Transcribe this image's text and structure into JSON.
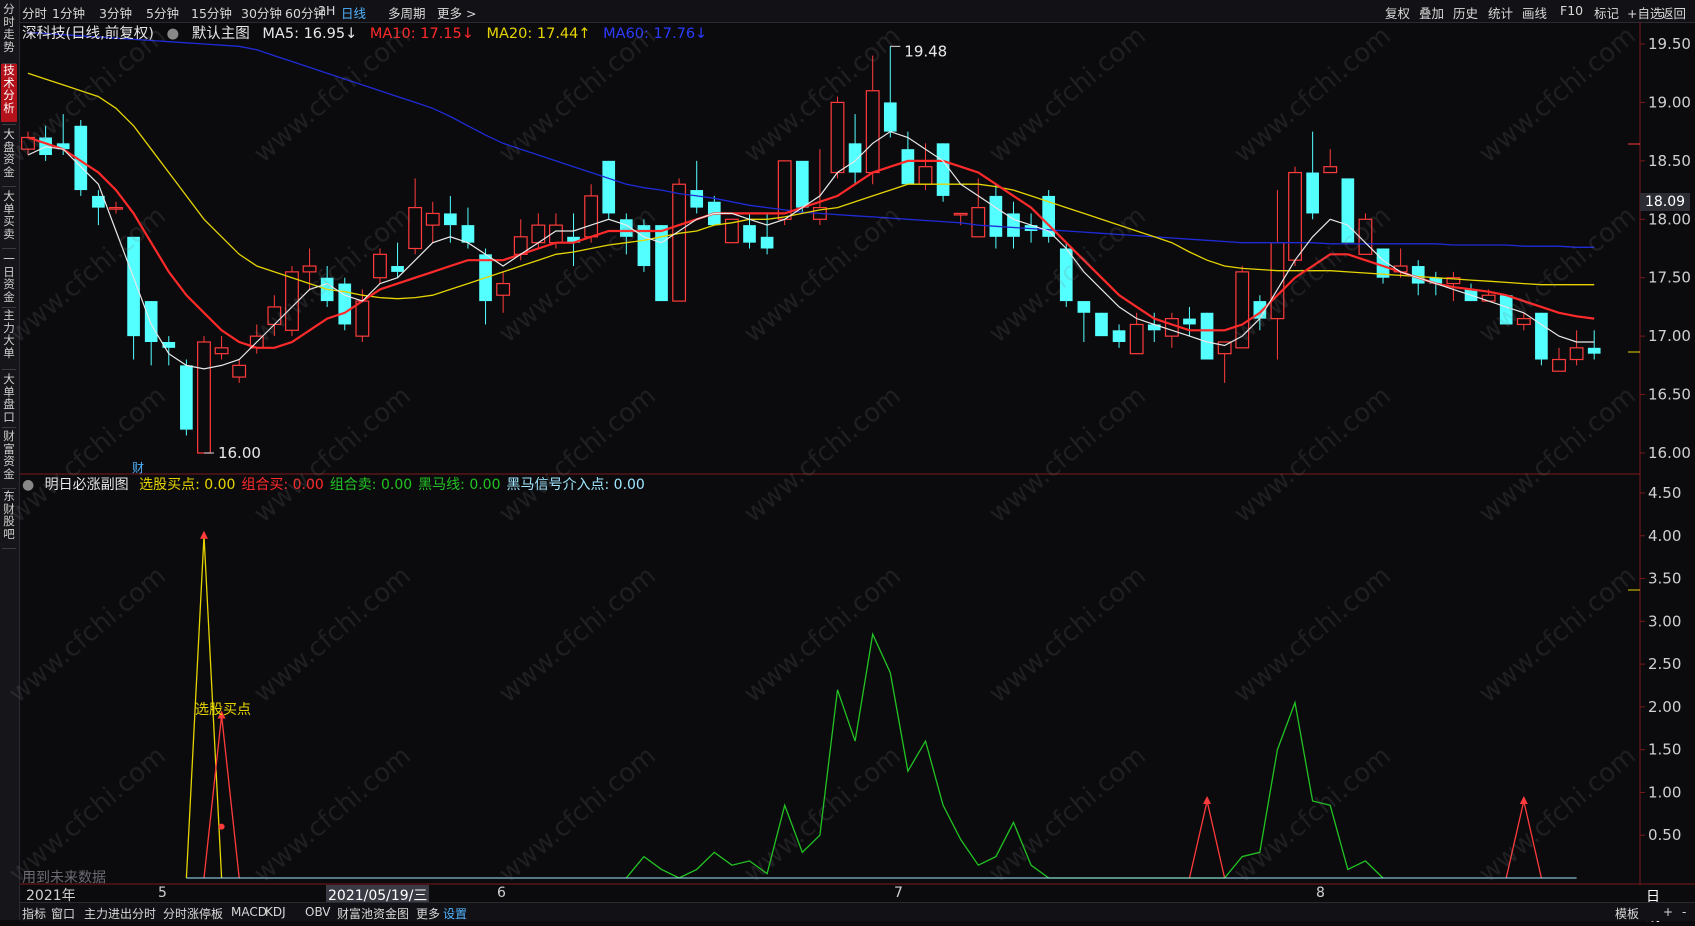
{
  "toolbar": {
    "left_items": [
      "分时",
      "1分钟",
      "3分钟",
      "5分钟",
      "15分钟",
      "30分钟",
      "60分钟",
      "2H",
      "日线",
      "多周期",
      "更多 >"
    ],
    "active": "日线",
    "right_items": [
      "复权",
      "叠加",
      "历史",
      "统计",
      "画线",
      "F10",
      "标记",
      "+自选",
      "返回"
    ]
  },
  "sidebar": {
    "items": [
      "分时走势",
      "技术分析",
      "大盘资金",
      "大单买卖",
      "一日资金",
      "主力大单",
      "大单盘口",
      "财富资金",
      "东财股吧"
    ],
    "active": "技术分析"
  },
  "main_info": {
    "stock": "深科技(日线,前复权)",
    "template": "默认主图",
    "ma5": "MA5: 16.95↓",
    "ma10": "MA10: 17.15↓",
    "ma20": "MA20: 17.44↑",
    "ma60": "MA60: 17.76↓"
  },
  "colors": {
    "up": "#ff3b3b",
    "down": "#54ffff",
    "ma5": "#e8e8e8",
    "ma10": "#ff2a2a",
    "ma20": "#e6d400",
    "ma60": "#1e2bd6"
  },
  "price_axis": {
    "labels": [
      "19.50",
      "19.00",
      "18.50",
      "18.00",
      "17.50",
      "17.00",
      "16.50",
      "16.00"
    ],
    "current": "18.09",
    "high_marker": "19.48",
    "low_marker": "16.00",
    "cai_marker": "财"
  },
  "indicator": {
    "title": "明日必涨副图",
    "items": [
      {
        "text": "选股买点: 0.00",
        "color": "#e6d400"
      },
      {
        "text": "组合买: 0.00",
        "color": "#ff2a2a"
      },
      {
        "text": "组合卖: 0.00",
        "color": "#22c322"
      },
      {
        "text": "黑马线: 0.00",
        "color": "#22c322"
      },
      {
        "text": "黑马信号介入点: 0.00",
        "color": "#9fe8ff"
      }
    ],
    "axis_labels": [
      "4.50",
      "4.00",
      "3.50",
      "3.00",
      "2.50",
      "2.00",
      "1.50",
      "1.00",
      "0.50"
    ],
    "buy_point_label": "选股买点",
    "future_data_label": "用到未来数据"
  },
  "x_axis": {
    "labels": [
      "2021年",
      "5",
      "2021/05/19/三",
      "6",
      "7",
      "8"
    ],
    "period_label": "日线"
  },
  "bottom_tabs": {
    "items": [
      "指标",
      "窗口",
      "主力进出分时",
      "分时涨停板",
      "MACD",
      "KDJ",
      "OBV",
      "财富池资金图",
      "更多",
      "设置"
    ],
    "active": "设置",
    "right": [
      "模板",
      "+",
      "-"
    ]
  },
  "watermark": "www.cfchi.com",
  "chart_data": [
    {
      "type": "candlestick",
      "title": "深科技(日线,前复权)",
      "ylim": [
        15.9,
        19.7
      ],
      "candles": [
        [
          18.6,
          18.7,
          18.55,
          18.75
        ],
        [
          18.7,
          18.55,
          18.5,
          18.8
        ],
        [
          18.65,
          18.6,
          18.55,
          18.9
        ],
        [
          18.8,
          18.25,
          18.2,
          18.85
        ],
        [
          18.2,
          18.1,
          17.95,
          18.25
        ],
        [
          18.1,
          18.1,
          18.05,
          18.15
        ],
        [
          17.85,
          17.0,
          16.8,
          17.85
        ],
        [
          17.3,
          16.95,
          16.75,
          17.3
        ],
        [
          16.95,
          16.9,
          16.75,
          17.0
        ],
        [
          16.75,
          16.2,
          16.15,
          16.8
        ],
        [
          16.0,
          16.95,
          16.0,
          17.0
        ],
        [
          16.85,
          16.9,
          16.8,
          17.0
        ],
        [
          16.65,
          16.75,
          16.6,
          16.8
        ],
        [
          16.9,
          17.0,
          16.85,
          17.1
        ],
        [
          17.1,
          17.25,
          17.0,
          17.35
        ],
        [
          17.05,
          17.55,
          17.0,
          17.6
        ],
        [
          17.55,
          17.6,
          17.4,
          17.75
        ],
        [
          17.5,
          17.3,
          17.25,
          17.6
        ],
        [
          17.45,
          17.1,
          17.05,
          17.5
        ],
        [
          17.0,
          17.3,
          16.95,
          17.4
        ],
        [
          17.5,
          17.7,
          17.45,
          17.75
        ],
        [
          17.6,
          17.55,
          17.5,
          17.8
        ],
        [
          17.75,
          18.1,
          17.7,
          18.35
        ],
        [
          17.95,
          18.05,
          17.8,
          18.15
        ],
        [
          18.05,
          17.95,
          17.8,
          18.2
        ],
        [
          17.95,
          17.8,
          17.75,
          18.1
        ],
        [
          17.7,
          17.3,
          17.1,
          17.75
        ],
        [
          17.35,
          17.45,
          17.2,
          17.55
        ],
        [
          17.7,
          17.85,
          17.65,
          18.0
        ],
        [
          17.8,
          17.95,
          17.75,
          18.05
        ],
        [
          17.8,
          17.95,
          17.75,
          18.05
        ],
        [
          17.85,
          17.8,
          17.6,
          18.05
        ],
        [
          17.85,
          18.2,
          17.8,
          18.3
        ],
        [
          18.5,
          18.05,
          18.0,
          18.5
        ],
        [
          18.0,
          17.85,
          17.7,
          18.05
        ],
        [
          17.95,
          17.6,
          17.55,
          18.0
        ],
        [
          17.95,
          17.3,
          17.3,
          17.95
        ],
        [
          17.3,
          18.3,
          17.3,
          18.35
        ],
        [
          18.25,
          18.1,
          18.05,
          18.5
        ],
        [
          18.15,
          17.95,
          17.95,
          18.2
        ],
        [
          17.8,
          18.0,
          17.85,
          18.0
        ],
        [
          17.95,
          17.8,
          17.75,
          18.05
        ],
        [
          17.85,
          17.75,
          17.7,
          18.05
        ],
        [
          18.0,
          18.5,
          17.95,
          18.5
        ],
        [
          18.5,
          18.1,
          18.05,
          18.5
        ],
        [
          18.0,
          18.1,
          17.95,
          18.6
        ],
        [
          18.4,
          19.0,
          18.35,
          19.05
        ],
        [
          18.65,
          18.4,
          18.3,
          18.9
        ],
        [
          18.4,
          19.1,
          18.3,
          19.4
        ],
        [
          19.0,
          18.75,
          18.7,
          19.48
        ],
        [
          18.6,
          18.3,
          18.3,
          18.75
        ],
        [
          18.3,
          18.45,
          18.25,
          18.65
        ],
        [
          18.65,
          18.2,
          18.15,
          18.65
        ],
        [
          18.05,
          18.05,
          17.95,
          18.05
        ],
        [
          17.85,
          18.1,
          17.95,
          18.35
        ],
        [
          18.2,
          17.85,
          17.75,
          18.3
        ],
        [
          18.05,
          17.85,
          17.75,
          18.15
        ],
        [
          17.95,
          17.9,
          17.8,
          18.05
        ],
        [
          18.2,
          17.85,
          17.8,
          18.25
        ],
        [
          17.75,
          17.3,
          17.25,
          17.8
        ],
        [
          17.3,
          17.2,
          16.95,
          17.3
        ],
        [
          17.2,
          17.0,
          17.0,
          17.2
        ],
        [
          17.05,
          16.95,
          16.9,
          17.1
        ],
        [
          16.85,
          17.1,
          16.85,
          17.2
        ],
        [
          17.1,
          17.05,
          16.95,
          17.2
        ],
        [
          17.0,
          17.15,
          16.9,
          17.2
        ],
        [
          17.15,
          17.1,
          17.0,
          17.25
        ],
        [
          17.2,
          16.8,
          16.8,
          17.2
        ],
        [
          16.85,
          16.95,
          16.6,
          16.9
        ],
        [
          16.9,
          17.55,
          16.9,
          17.6
        ],
        [
          17.3,
          17.15,
          17.05,
          17.35
        ],
        [
          17.15,
          17.8,
          16.8,
          18.25
        ],
        [
          17.65,
          18.4,
          17.6,
          18.45
        ],
        [
          18.4,
          18.05,
          18.0,
          18.75
        ],
        [
          18.4,
          18.45,
          18.4,
          18.6
        ],
        [
          18.35,
          17.8,
          17.8,
          18.3
        ],
        [
          17.7,
          18.0,
          17.8,
          18.05
        ],
        [
          17.75,
          17.5,
          17.45,
          17.75
        ],
        [
          17.55,
          17.6,
          17.5,
          17.75
        ],
        [
          17.6,
          17.45,
          17.35,
          17.65
        ],
        [
          17.5,
          17.45,
          17.35,
          17.55
        ],
        [
          17.45,
          17.5,
          17.3,
          17.55
        ],
        [
          17.4,
          17.3,
          17.3,
          17.45
        ],
        [
          17.3,
          17.35,
          17.3,
          17.4
        ],
        [
          17.35,
          17.1,
          17.1,
          17.35
        ],
        [
          17.1,
          17.15,
          17.05,
          17.2
        ],
        [
          17.2,
          16.8,
          16.75,
          17.2
        ],
        [
          16.7,
          16.8,
          16.7,
          16.9
        ],
        [
          16.8,
          16.9,
          16.75,
          17.05
        ],
        [
          16.9,
          16.85,
          16.8,
          17.05
        ]
      ],
      "ma5": [
        18.55,
        18.62,
        18.6,
        18.45,
        18.3,
        17.9,
        17.5,
        17.1,
        16.85,
        16.75,
        16.72,
        16.75,
        16.8,
        16.95,
        17.1,
        17.25,
        17.4,
        17.45,
        17.35,
        17.3,
        17.45,
        17.5,
        17.65,
        17.8,
        17.85,
        17.8,
        17.7,
        17.6,
        17.7,
        17.8,
        17.9,
        17.9,
        17.95,
        18.0,
        17.95,
        17.85,
        17.8,
        17.9,
        18.0,
        18.05,
        18.05,
        18.0,
        17.95,
        18.0,
        18.1,
        18.2,
        18.4,
        18.5,
        18.65,
        18.75,
        18.7,
        18.6,
        18.5,
        18.3,
        18.2,
        18.1,
        18.0,
        17.95,
        17.9,
        17.75,
        17.55,
        17.4,
        17.25,
        17.15,
        17.1,
        17.05,
        17.0,
        16.95,
        16.92,
        17.0,
        17.15,
        17.4,
        17.65,
        17.85,
        18.0,
        17.95,
        17.8,
        17.65,
        17.55,
        17.5,
        17.45,
        17.4,
        17.35,
        17.3,
        17.25,
        17.2,
        17.1,
        17.0,
        16.95,
        16.95
      ],
      "ma10": [
        18.7,
        18.65,
        18.6,
        18.5,
        18.4,
        18.25,
        18.05,
        17.8,
        17.55,
        17.35,
        17.2,
        17.05,
        16.95,
        16.9,
        16.9,
        16.95,
        17.05,
        17.15,
        17.2,
        17.3,
        17.4,
        17.45,
        17.5,
        17.55,
        17.6,
        17.65,
        17.65,
        17.65,
        17.7,
        17.75,
        17.8,
        17.8,
        17.85,
        17.9,
        17.9,
        17.9,
        17.9,
        17.95,
        18.0,
        18.05,
        18.05,
        18.05,
        18.05,
        18.05,
        18.1,
        18.15,
        18.2,
        18.3,
        18.4,
        18.45,
        18.5,
        18.5,
        18.5,
        18.45,
        18.4,
        18.3,
        18.2,
        18.1,
        17.95,
        17.8,
        17.65,
        17.5,
        17.35,
        17.25,
        17.15,
        17.1,
        17.05,
        17.05,
        17.05,
        17.1,
        17.2,
        17.35,
        17.5,
        17.6,
        17.7,
        17.7,
        17.65,
        17.6,
        17.55,
        17.5,
        17.45,
        17.42,
        17.4,
        17.38,
        17.35,
        17.3,
        17.25,
        17.2,
        17.17,
        17.15
      ],
      "ma20": [
        19.25,
        19.2,
        19.15,
        19.1,
        19.05,
        18.95,
        18.8,
        18.6,
        18.4,
        18.2,
        18.0,
        17.85,
        17.7,
        17.6,
        17.55,
        17.5,
        17.45,
        17.4,
        17.38,
        17.35,
        17.33,
        17.32,
        17.33,
        17.35,
        17.4,
        17.45,
        17.5,
        17.55,
        17.6,
        17.65,
        17.7,
        17.72,
        17.75,
        17.78,
        17.8,
        17.82,
        17.85,
        17.88,
        17.9,
        17.95,
        17.97,
        18.0,
        18.0,
        18.02,
        18.05,
        18.08,
        18.1,
        18.15,
        18.2,
        18.25,
        18.3,
        18.3,
        18.3,
        18.3,
        18.3,
        18.28,
        18.25,
        18.2,
        18.15,
        18.1,
        18.05,
        18.0,
        17.95,
        17.9,
        17.85,
        17.8,
        17.72,
        17.65,
        17.6,
        17.58,
        17.57,
        17.56,
        17.56,
        17.56,
        17.56,
        17.55,
        17.54,
        17.53,
        17.52,
        17.51,
        17.5,
        17.49,
        17.48,
        17.47,
        17.46,
        17.45,
        17.44,
        17.44,
        17.44,
        17.44
      ],
      "ma60": [
        19.6,
        19.59,
        19.58,
        19.57,
        19.56,
        19.55,
        19.54,
        19.53,
        19.52,
        19.51,
        19.5,
        19.49,
        19.48,
        19.45,
        19.4,
        19.35,
        19.3,
        19.25,
        19.2,
        19.15,
        19.1,
        19.05,
        19.0,
        18.95,
        18.88,
        18.8,
        18.72,
        18.65,
        18.6,
        18.55,
        18.5,
        18.45,
        18.4,
        18.35,
        18.3,
        18.27,
        18.25,
        18.22,
        18.2,
        18.18,
        18.15,
        18.12,
        18.1,
        18.08,
        18.06,
        18.05,
        18.04,
        18.03,
        18.02,
        18.01,
        18.0,
        17.99,
        17.98,
        17.97,
        17.95,
        17.94,
        17.93,
        17.92,
        17.91,
        17.9,
        17.89,
        17.88,
        17.87,
        17.86,
        17.85,
        17.84,
        17.83,
        17.82,
        17.81,
        17.8,
        17.8,
        17.8,
        17.8,
        17.8,
        17.79,
        17.79,
        17.79,
        17.79,
        17.79,
        17.79,
        17.79,
        17.78,
        17.78,
        17.78,
        17.78,
        17.77,
        17.77,
        17.77,
        17.76,
        17.76
      ]
    },
    {
      "type": "line",
      "title": "明日必涨副图",
      "ylim": [
        0,
        4.7
      ],
      "series": [
        {
          "name": "选股买点",
          "points": [
            [
              9,
              0
            ],
            [
              10,
              4.0
            ],
            [
              11,
              0
            ]
          ]
        },
        {
          "name": "组合买",
          "points": [
            [
              10,
              0
            ],
            [
              11,
              1.9
            ],
            [
              12,
              0
            ]
          ]
        },
        {
          "name": "组合买",
          "points": [
            [
              66,
              0
            ],
            [
              67,
              0.9
            ],
            [
              68,
              0
            ]
          ]
        },
        {
          "name": "组合买",
          "points": [
            [
              84,
              0
            ],
            [
              85,
              0.9
            ],
            [
              86,
              0
            ]
          ]
        },
        {
          "name": "黑马线",
          "points": [
            [
              34,
              0
            ],
            [
              35,
              0.25
            ],
            [
              36,
              0.1
            ],
            [
              37,
              0
            ],
            [
              38,
              0.1
            ],
            [
              39,
              0.3
            ],
            [
              40,
              0.15
            ],
            [
              41,
              0.2
            ],
            [
              42,
              0.05
            ],
            [
              43,
              0.85
            ],
            [
              44,
              0.3
            ],
            [
              45,
              0.5
            ],
            [
              46,
              2.2
            ],
            [
              47,
              1.6
            ],
            [
              48,
              2.85
            ],
            [
              49,
              2.4
            ],
            [
              50,
              1.25
            ],
            [
              51,
              1.6
            ],
            [
              52,
              0.85
            ],
            [
              53,
              0.45
            ],
            [
              54,
              0.15
            ],
            [
              55,
              0.25
            ],
            [
              56,
              0.65
            ],
            [
              57,
              0.15
            ],
            [
              58,
              0
            ],
            [
              68,
              0
            ],
            [
              69,
              0.25
            ],
            [
              70,
              0.3
            ],
            [
              71,
              1.5
            ],
            [
              72,
              2.05
            ],
            [
              73,
              0.9
            ],
            [
              74,
              0.85
            ],
            [
              75,
              0.1
            ],
            [
              76,
              0.2
            ],
            [
              77,
              0
            ]
          ]
        }
      ],
      "markers": [
        {
          "series": "组合买",
          "x": 11,
          "y": 0.6
        }
      ]
    }
  ]
}
